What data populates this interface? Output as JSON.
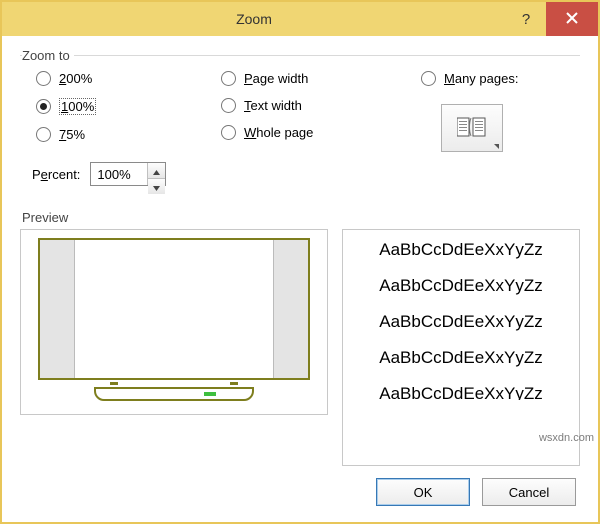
{
  "window": {
    "title": "Zoom"
  },
  "zoom_to": {
    "legend": "Zoom to",
    "col1": [
      {
        "key": "200",
        "accel": "2",
        "rest": "00%",
        "selected": false
      },
      {
        "key": "100",
        "accel": "1",
        "rest": "00%",
        "selected": true
      },
      {
        "key": "75",
        "accel": "7",
        "rest": "5%",
        "selected": false
      }
    ],
    "col2": [
      {
        "key": "page_width",
        "accel": "P",
        "rest": "age width"
      },
      {
        "key": "text_width",
        "accel": "T",
        "rest": "ext width"
      },
      {
        "key": "whole_page",
        "accel": "W",
        "rest": "hole page"
      }
    ],
    "many_pages": {
      "label_accel": "M",
      "label_rest": "any pages:"
    }
  },
  "percent": {
    "label_pre": "P",
    "label_accel": "e",
    "label_rest": "rcent:",
    "value": "100%"
  },
  "preview": {
    "label": "Preview",
    "sample_line": "AaBbCcDdEeXxYyZz"
  },
  "buttons": {
    "ok": "OK",
    "cancel": "Cancel"
  },
  "watermark": "wsxdn.com"
}
